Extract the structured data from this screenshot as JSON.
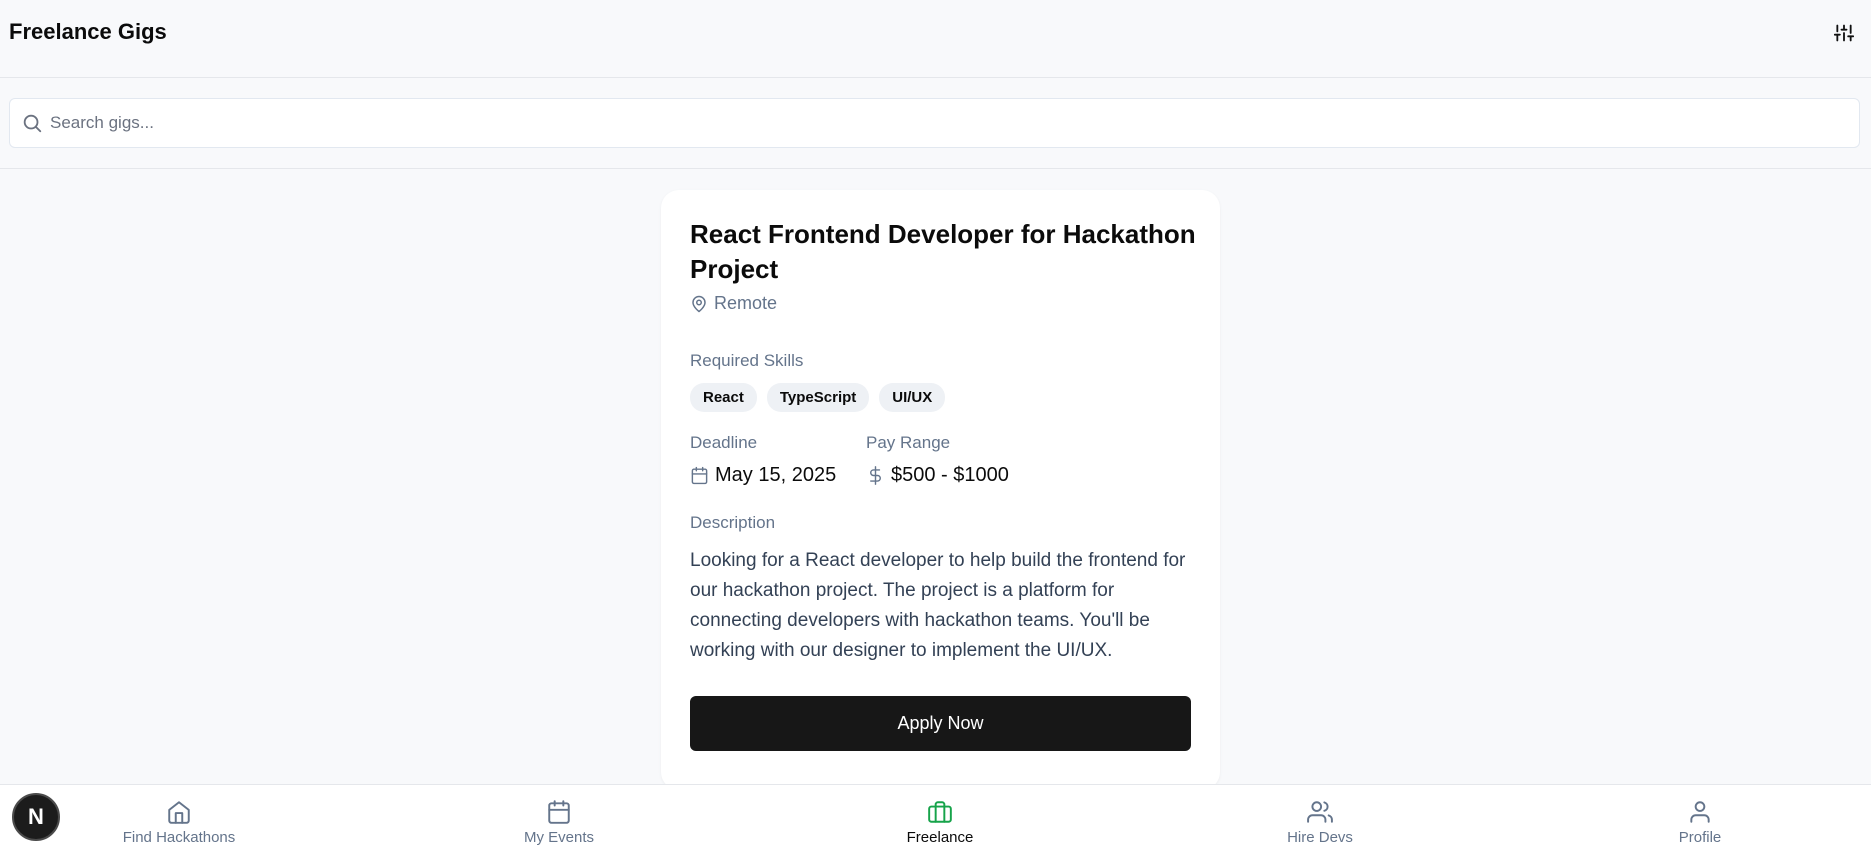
{
  "header": {
    "title": "Freelance Gigs",
    "filter_icon": "sliders-icon"
  },
  "search": {
    "placeholder": "Search gigs...",
    "value": ""
  },
  "gig": {
    "title": "React Frontend Developer for Hackathon Project",
    "location": "Remote",
    "skills_label": "Required Skills",
    "skills": [
      "React",
      "TypeScript",
      "UI/UX"
    ],
    "deadline_label": "Deadline",
    "deadline": "May 15, 2025",
    "pay_label": "Pay Range",
    "pay": "$500 - $1000",
    "description_label": "Description",
    "description": "Looking for a React developer to help build the frontend for our hackathon project. The project is a platform for connecting developers with hackathon teams. You'll be working with our designer to implement the UI/UX.",
    "apply_label": "Apply Now"
  },
  "nav": {
    "items": [
      {
        "label": "Find Hackathons",
        "icon": "home-icon",
        "active": false
      },
      {
        "label": "My Events",
        "icon": "calendar-icon",
        "active": false
      },
      {
        "label": "Freelance",
        "icon": "briefcase-icon",
        "active": true
      },
      {
        "label": "Hire Devs",
        "icon": "users-icon",
        "active": false
      },
      {
        "label": "Profile",
        "icon": "user-icon",
        "active": false
      }
    ]
  },
  "avatar": {
    "letter": "N"
  },
  "colors": {
    "accent_active": "#16a34a",
    "muted": "#64748b",
    "button_bg": "#171717",
    "page_bg": "#f8f9fb"
  }
}
